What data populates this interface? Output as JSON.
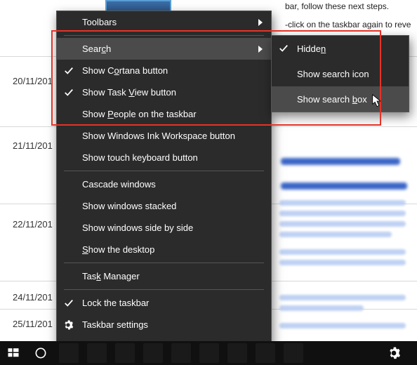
{
  "bg": {
    "dates": [
      "20/11/201",
      "21/11/201",
      "22/11/201",
      "24/11/201",
      "25/11/201"
    ],
    "topline1": "bar, follow these next steps.",
    "topline2": "-click on the taskbar again to reveal th"
  },
  "menu": {
    "toolbars": "Toolbars",
    "search": "Search",
    "cortana": "Show Cortana button",
    "taskview": "Show Task View button",
    "people": "Show People on the taskbar",
    "ink": "Show Windows Ink Workspace button",
    "touchkb": "Show touch keyboard button",
    "cascade": "Cascade windows",
    "stacked": "Show windows stacked",
    "sidebyside": "Show windows side by side",
    "desktop": "Show the desktop",
    "taskmgr": "Task Manager",
    "lock": "Lock the taskbar",
    "settings": "Taskbar settings"
  },
  "submenu": {
    "hidden": "Hidden",
    "icon": "Show search icon",
    "box": "Show search box"
  }
}
